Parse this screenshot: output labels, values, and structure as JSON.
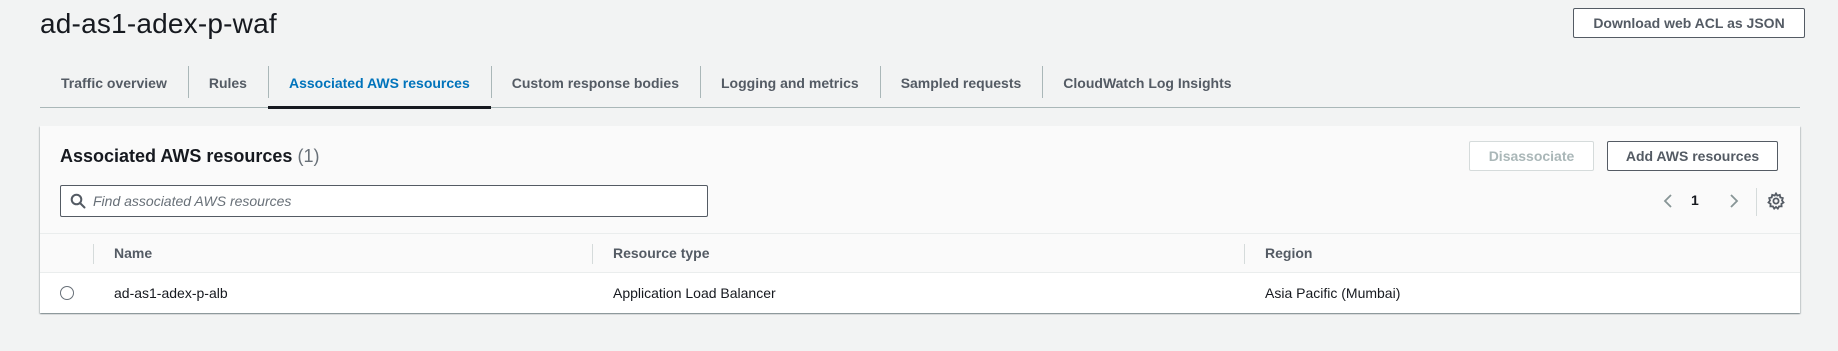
{
  "header": {
    "title": "ad-as1-adex-p-waf",
    "download_label": "Download web ACL as JSON"
  },
  "tabs": [
    {
      "label": "Traffic overview"
    },
    {
      "label": "Rules"
    },
    {
      "label": "Associated AWS resources",
      "active": true
    },
    {
      "label": "Custom response bodies"
    },
    {
      "label": "Logging and metrics"
    },
    {
      "label": "Sampled requests"
    },
    {
      "label": "CloudWatch Log Insights"
    }
  ],
  "panel": {
    "title": "Associated AWS resources",
    "count": "(1)",
    "disassociate_label": "Disassociate",
    "add_label": "Add AWS resources",
    "search_placeholder": "Find associated AWS resources",
    "search_value": "",
    "page_number": "1",
    "columns": [
      "Name",
      "Resource type",
      "Region"
    ],
    "rows": [
      {
        "name": "ad-as1-adex-p-alb",
        "type": "Application Load Balancer",
        "region": "Asia Pacific (Mumbai)"
      }
    ]
  },
  "colors": {
    "accent": "#0073bb",
    "text": "#16191f",
    "muted": "#545b64",
    "background": "#f2f3f3"
  },
  "icons": {
    "search": "search-icon",
    "prev": "chevron-left-icon",
    "next": "chevron-right-icon",
    "settings": "gear-icon",
    "select": "radio-icon"
  }
}
